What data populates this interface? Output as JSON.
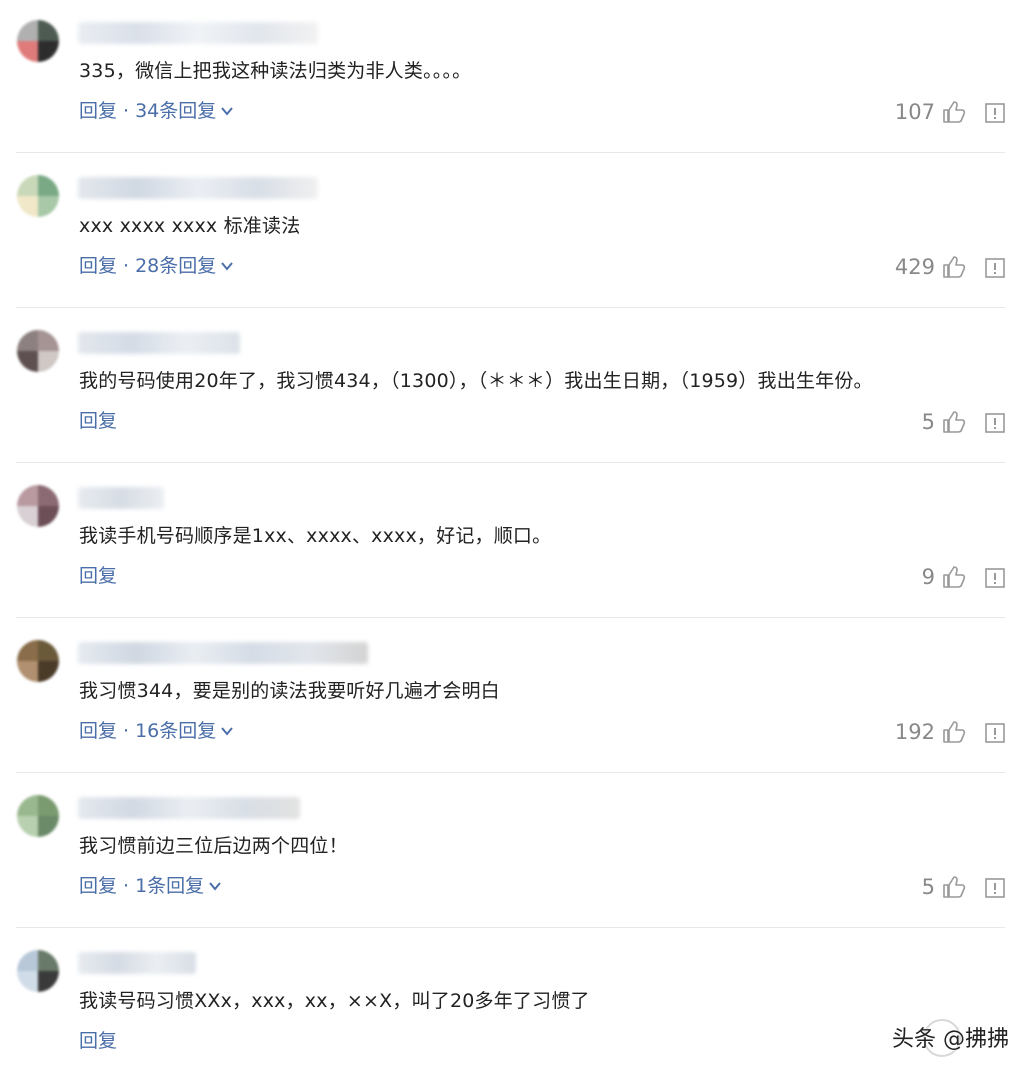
{
  "comments": [
    {
      "text": "335，微信上把我这种读法归类为非人类。。。。",
      "reply_label": "回复",
      "replies_label": "34条回复",
      "likes": "107",
      "avatar_colors": [
        "#b0b0b0",
        "#4d5b52",
        "#e07b7b",
        "#2d2d2d"
      ]
    },
    {
      "text": "xxx xxxx xxxx 标准读法",
      "reply_label": "回复",
      "replies_label": "28条回复",
      "likes": "429",
      "avatar_colors": [
        "#c8d8b8",
        "#7aa985",
        "#f0e8c8",
        "#a8c8a8"
      ]
    },
    {
      "text": "我的号码使用20年了，我习惯434，（1300），（＊＊＊）我出生日期，（1959）我出生年份。",
      "reply_label": "回复",
      "replies_label": "",
      "likes": "5",
      "avatar_colors": [
        "#8c8080",
        "#a69494",
        "#5e5050",
        "#cfc8c4"
      ]
    },
    {
      "text": "我读手机号码顺序是1xx、xxxx、xxxx，好记，顺口。",
      "reply_label": "回复",
      "replies_label": "",
      "likes": "9",
      "avatar_colors": [
        "#b89aa0",
        "#8c6a74",
        "#d8d0d4",
        "#6d4f58"
      ]
    },
    {
      "text": "我习惯344，要是别的读法我要听好几遍才会明白",
      "reply_label": "回复",
      "replies_label": "16条回复",
      "likes": "192",
      "avatar_colors": [
        "#8a6d4a",
        "#6b5a3a",
        "#b09070",
        "#4a3a28"
      ]
    },
    {
      "text": "我习惯前边三位后边两个四位！",
      "reply_label": "回复",
      "replies_label": "1条回复",
      "likes": "5",
      "avatar_colors": [
        "#9ab890",
        "#7a9a70",
        "#b8d0b0",
        "#6a8a68"
      ]
    },
    {
      "text": "我读号码习惯XXx，xxx，xx，××X，叫了20多年了习惯了",
      "reply_label": "回复",
      "replies_label": "",
      "likes": "",
      "avatar_colors": [
        "#b8c8d8",
        "#6a7a6a",
        "#d0dce8",
        "#3a3a3a"
      ]
    }
  ],
  "separator": "·",
  "watermark": "头条 @拂拂",
  "colors": {
    "reply_link": "#4a6ea8",
    "likes_text": "#888888",
    "divider": "#e8e8e8"
  }
}
